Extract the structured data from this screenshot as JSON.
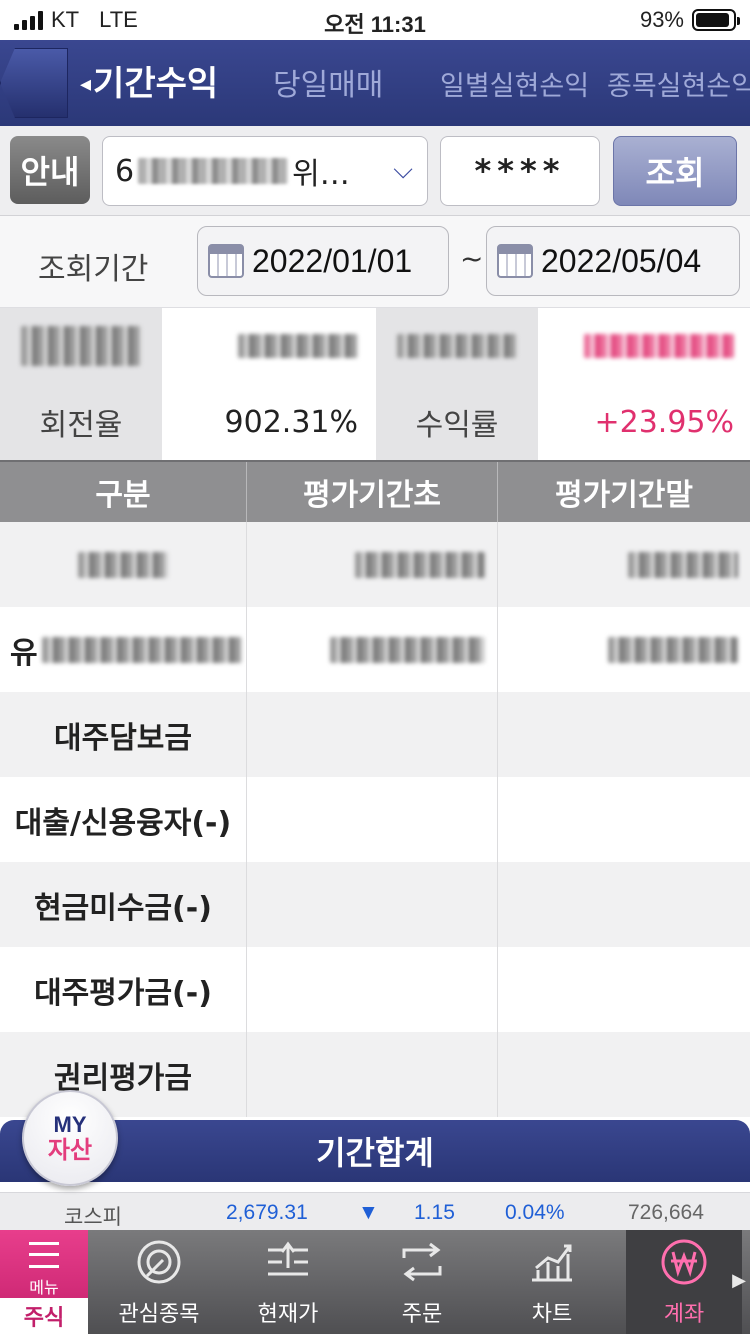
{
  "status_bar": {
    "carrier": "KT",
    "network": "LTE",
    "time": "오전 11:31",
    "battery": "93%",
    "battery_level": 0.93
  },
  "header": {
    "tabs": [
      {
        "label": "기간수익",
        "active": true
      },
      {
        "label": "당일매매",
        "active": false
      },
      {
        "label": "일별실현손익",
        "active": false
      },
      {
        "label": "종목실현손익",
        "active": false
      }
    ]
  },
  "account": {
    "guide_label": "안내",
    "account_prefix": "6",
    "account_suffix": "위…",
    "password_mask": "****",
    "query_label": "조회"
  },
  "period": {
    "label": "조회기간",
    "start": "2022/01/01",
    "separator": "~",
    "end": "2022/05/04"
  },
  "summary": {
    "turnover_label": "회전율",
    "turnover_value": "902.31%",
    "return_label": "수익률",
    "return_value": "+23.95%"
  },
  "table": {
    "headers": [
      "구분",
      "평가기간초",
      "평가기간말"
    ],
    "rows": [
      {
        "label": "",
        "start": "",
        "end": ""
      },
      {
        "label": "유",
        "start": "",
        "end": ""
      },
      {
        "label": "대주담보금",
        "start": "",
        "end": ""
      },
      {
        "label": "대출/신용융자(-)",
        "start": "",
        "end": ""
      },
      {
        "label": "현금미수금(-)",
        "start": "",
        "end": ""
      },
      {
        "label": "대주평가금(-)",
        "start": "",
        "end": ""
      },
      {
        "label": "권리평가금",
        "start": "",
        "end": ""
      }
    ]
  },
  "total_bar": {
    "label": "기간합계"
  },
  "my_asset": {
    "top": "MY",
    "bottom": "자산"
  },
  "ticker": {
    "name": "코스피",
    "price": "2,679.31",
    "direction": "▼",
    "change": "1.15",
    "rate": "0.04%",
    "volume": "726,664"
  },
  "bottom_nav": {
    "menu_label": "메뉴",
    "menu_main": "주식",
    "items": [
      {
        "label": "관심종목",
        "icon": "watchlist-icon"
      },
      {
        "label": "현재가",
        "icon": "current-price-icon"
      },
      {
        "label": "주문",
        "icon": "order-icon"
      },
      {
        "label": "차트",
        "icon": "chart-icon"
      },
      {
        "label": "계좌",
        "icon": "won-account-icon",
        "active": true
      }
    ]
  },
  "colors": {
    "header_bg": "#2b3878",
    "positive": "#e0306e",
    "ticker_blue": "#1f5fd6",
    "menu_pink": "#e83e8c"
  }
}
